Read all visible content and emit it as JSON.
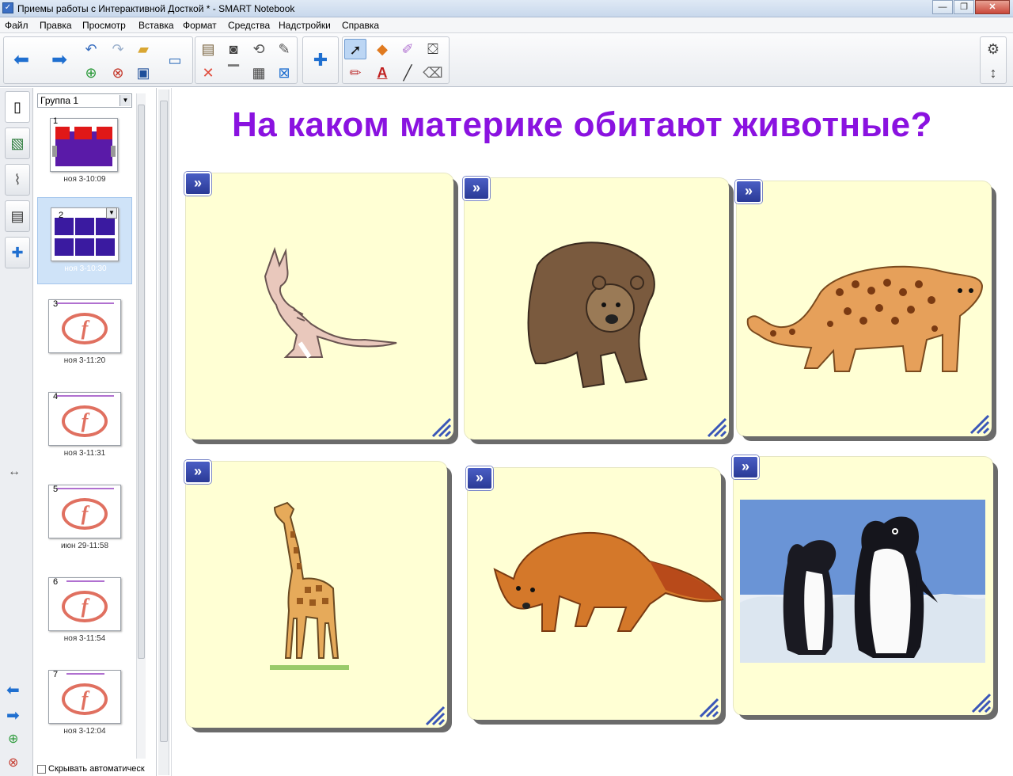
{
  "window": {
    "title": "Приемы работы с Интерактивной Досткой * - SMART Notebook",
    "minimize": "—",
    "maximize": "❐",
    "close": "✕"
  },
  "menu": {
    "items": [
      {
        "label": "Файл"
      },
      {
        "label": "Правка"
      },
      {
        "label": "Просмотр"
      },
      {
        "label": "Вставка"
      },
      {
        "label": "Формат"
      },
      {
        "label": "Средства"
      },
      {
        "label": "Надстройки"
      },
      {
        "label": "Справка"
      }
    ]
  },
  "toolbar": {
    "back_icon": "arrow-left-icon",
    "forward_icon": "arrow-right-icon",
    "settings_icon": "gear-icon",
    "resize_icon": "resize-icon",
    "text_tool_label": "A"
  },
  "sorter": {
    "group_select": "Группа 1",
    "hide_auto_label": "Скрывать автоматическ",
    "thumbnails": [
      {
        "num": "1",
        "label": "ноя 3-10:09"
      },
      {
        "num": "2",
        "label": "ноя 3-10:30"
      },
      {
        "num": "3",
        "label": "ноя 3-11:20"
      },
      {
        "num": "4",
        "label": "ноя 3-11:31"
      },
      {
        "num": "5",
        "label": "июн 29-11:58"
      },
      {
        "num": "6",
        "label": "ноя 3-11:54"
      },
      {
        "num": "7",
        "label": "ноя 3-12:04"
      }
    ]
  },
  "page": {
    "title": "На каком материке обитают животные?",
    "cards": [
      {
        "animal": "kangaroo"
      },
      {
        "animal": "bear"
      },
      {
        "animal": "jaguar"
      },
      {
        "animal": "giraffe"
      },
      {
        "animal": "fox"
      },
      {
        "animal": "penguins"
      }
    ]
  },
  "colors": {
    "title": "#8a12e0",
    "card_bg": "#ffffd4",
    "expand_button": "#2a3a96",
    "selected_thumb": "#cfe3f8"
  }
}
